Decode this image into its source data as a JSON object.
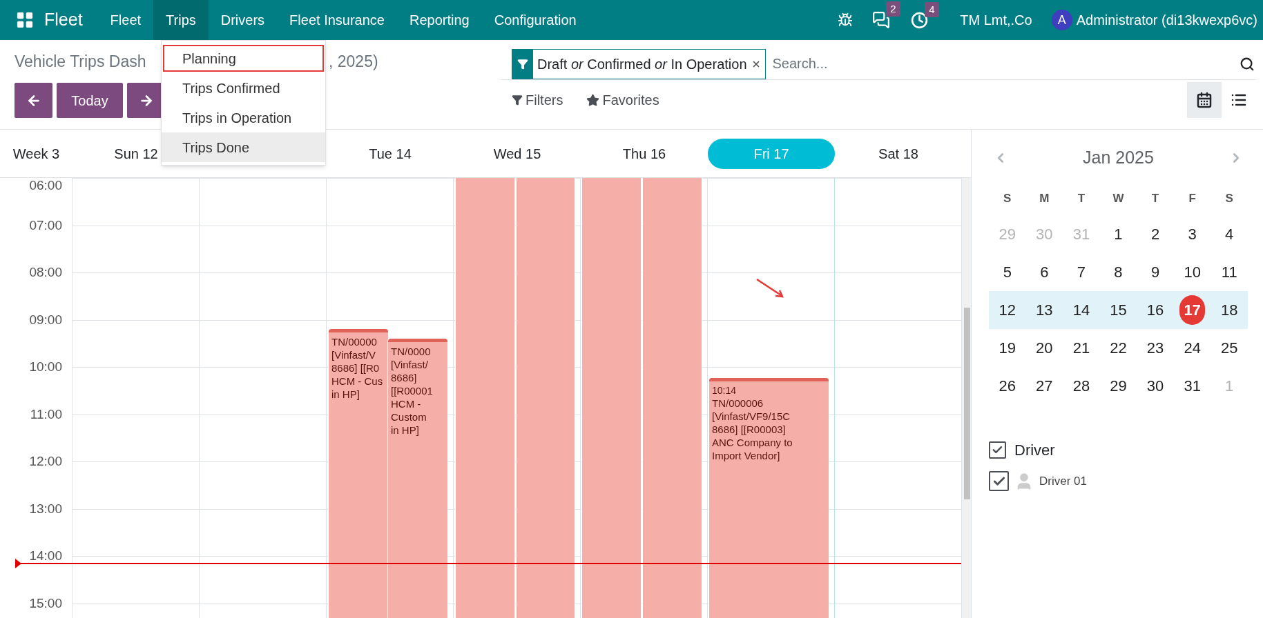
{
  "navbar": {
    "app_name": "Fleet",
    "menus": [
      {
        "label": "Fleet",
        "selected": false
      },
      {
        "label": "Trips",
        "selected": true
      },
      {
        "label": "Drivers",
        "selected": false
      },
      {
        "label": "Fleet Insurance",
        "selected": false
      },
      {
        "label": "Reporting",
        "selected": false
      },
      {
        "label": "Configuration",
        "selected": false
      }
    ],
    "chat_badge": "2",
    "activity_badge": "4",
    "company": "TM Lmt,.Co",
    "avatar_letter": "A",
    "user": "Administrator (di13kwexp6vc)"
  },
  "trips_menu": {
    "items": [
      {
        "label": "Planning",
        "hovered": false,
        "outlined": true
      },
      {
        "label": "Trips Confirmed",
        "hovered": false,
        "outlined": false
      },
      {
        "label": "Trips in Operation",
        "hovered": false,
        "outlined": false
      },
      {
        "label": "Trips Done",
        "hovered": true,
        "outlined": false
      }
    ]
  },
  "control_panel": {
    "title_start": "Vehicle Trips Dash",
    "title_end": ", 2025)",
    "today_button": "Today",
    "search": {
      "facet": "Draft *or* Confirmed *or* In Operation",
      "placeholder": "Search..."
    },
    "filters_button": "Filters",
    "favorites_button": "Favorites",
    "views": [
      {
        "kind": "calendar",
        "selected": true
      },
      {
        "kind": "list",
        "selected": false
      }
    ]
  },
  "calendar": {
    "week_label": "Week 3",
    "hours": [
      "06:00",
      "07:00",
      "08:00",
      "09:00",
      "10:00",
      "11:00",
      "12:00",
      "13:00",
      "14:00",
      "15:00"
    ],
    "days": [
      {
        "label": "Sun 12",
        "selected": false
      },
      {
        "selected": false
      },
      {
        "label": "Tue 14",
        "selected": false,
        "events": [
          {
            "kind": "trip",
            "lines": [
              "TN/00000",
              "[Vinfast/V",
              "8686] [[R0",
              "HCM - Cus",
              "in HP]"
            ]
          },
          {
            "kind": "trip",
            "lines": [
              "TN/0000",
              "[Vinfast/",
              "8686]",
              "[[R00001",
              "HCM -",
              "Custom",
              "in HP]"
            ]
          }
        ]
      },
      {
        "label": "Wed 15",
        "selected": false,
        "events": [
          {
            "kind": "trip"
          },
          {
            "kind": "trip"
          }
        ]
      },
      {
        "label": "Thu 16",
        "selected": false,
        "events": [
          {
            "kind": "trip"
          },
          {
            "kind": "trip"
          }
        ]
      },
      {
        "label": "Fri 17",
        "selected": true,
        "events": [
          {
            "kind": "trip",
            "time": "10:14",
            "lines": [
              "TN/000006",
              "[Vinfast/VF9/15C",
              "8686] [[R00003]",
              "ANC Company to",
              "Import Vendor]"
            ]
          }
        ]
      },
      {
        "label": "Sat 18",
        "selected": false
      }
    ]
  },
  "sidebar": {
    "month": "Jan 2025",
    "weekdays": [
      "S",
      "M",
      "T",
      "W",
      "T",
      "F",
      "S"
    ],
    "weeks": [
      {
        "selected": false,
        "days": [
          {
            "label": "29",
            "other_month": true,
            "today": false
          },
          {
            "label": "30",
            "other_month": true,
            "today": false
          },
          {
            "label": "31",
            "other_month": true,
            "today": false
          },
          {
            "label": "1",
            "other_month": false,
            "today": false
          },
          {
            "label": "2",
            "other_month": false,
            "today": false
          },
          {
            "label": "3",
            "other_month": false,
            "today": false
          },
          {
            "label": "4",
            "other_month": false,
            "today": false
          }
        ]
      },
      {
        "selected": false,
        "days": [
          {
            "label": "5",
            "other_month": false,
            "today": false
          },
          {
            "label": "6",
            "other_month": false,
            "today": false
          },
          {
            "label": "7",
            "other_month": false,
            "today": false
          },
          {
            "label": "8",
            "other_month": false,
            "today": false
          },
          {
            "label": "9",
            "other_month": false,
            "today": false
          },
          {
            "label": "10",
            "other_month": false,
            "today": false
          },
          {
            "label": "11",
            "other_month": false,
            "today": false
          }
        ]
      },
      {
        "selected": true,
        "days": [
          {
            "label": "12",
            "other_month": false,
            "today": false
          },
          {
            "label": "13",
            "other_month": false,
            "today": false
          },
          {
            "label": "14",
            "other_month": false,
            "today": false
          },
          {
            "label": "15",
            "other_month": false,
            "today": false
          },
          {
            "label": "16",
            "other_month": false,
            "today": false
          },
          {
            "label": "17",
            "other_month": false,
            "today": true
          },
          {
            "label": "18",
            "other_month": false,
            "today": false
          }
        ]
      },
      {
        "selected": false,
        "days": [
          {
            "label": "19",
            "other_month": false,
            "today": false
          },
          {
            "label": "20",
            "other_month": false,
            "today": false
          },
          {
            "label": "21",
            "other_month": false,
            "today": false
          },
          {
            "label": "22",
            "other_month": false,
            "today": false
          },
          {
            "label": "23",
            "other_month": false,
            "today": false
          },
          {
            "label": "24",
            "other_month": false,
            "today": false
          },
          {
            "label": "25",
            "other_month": false,
            "today": false
          }
        ]
      },
      {
        "selected": false,
        "days": [
          {
            "label": "26",
            "other_month": false,
            "today": false
          },
          {
            "label": "27",
            "other_month": false,
            "today": false
          },
          {
            "label": "28",
            "other_month": false,
            "today": false
          },
          {
            "label": "29",
            "other_month": false,
            "today": false
          },
          {
            "label": "30",
            "other_month": false,
            "today": false
          },
          {
            "label": "31",
            "other_month": false,
            "today": false
          },
          {
            "label": "1",
            "other_month": true,
            "today": false
          }
        ]
      }
    ],
    "filter": {
      "title": "Driver",
      "checked": true,
      "items": [
        {
          "label": "Driver 01",
          "checked": true
        }
      ]
    }
  }
}
